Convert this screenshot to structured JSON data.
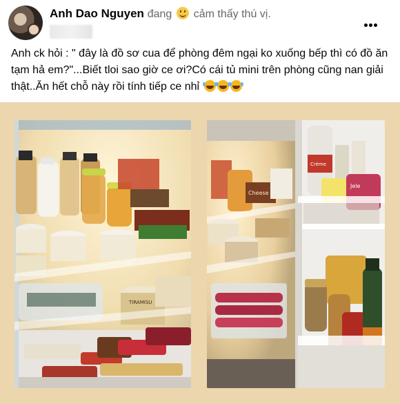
{
  "post": {
    "author": "Anh Dao Nguyen",
    "feeling_prefix": "đang",
    "feeling_icon": "smile-emoji-icon",
    "feeling_text": "cảm thấy thú vị.",
    "more_icon": "more-options-icon",
    "text": "Anh ck hỏi : \" đây là đồ sơ cua để phòng đêm ngại ko xuống bếp thì có đồ ăn tạm hả em?\"...Biết tloi sao giờ ce ơi?Có cái tủ mini trên phòng cũng nan giải thật..Ăn hết chỗ này rồi tính tiếp ce nhỉ",
    "trailing_emoji_icon": "rolling-on-floor-laughing-icon",
    "trailing_emoji_count": 3
  },
  "photos": {
    "background": "#ecd6ad",
    "left_label": "TIRAMISU",
    "right_labels": {
      "sign": "Cheese",
      "jar": "Crème",
      "pouch": "Jele"
    }
  }
}
